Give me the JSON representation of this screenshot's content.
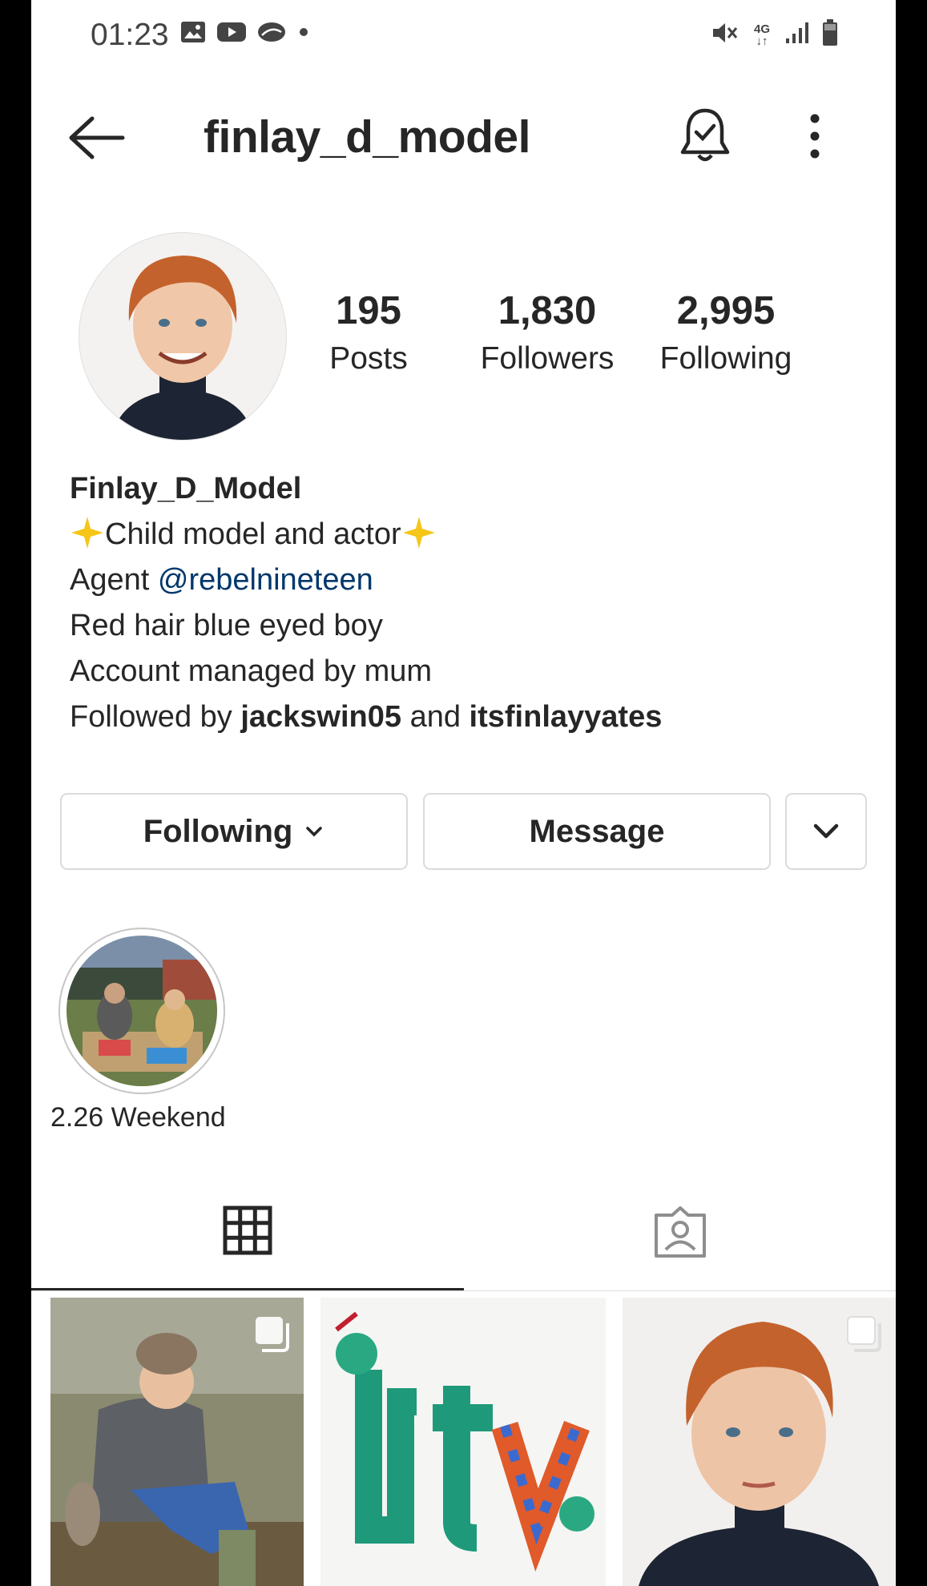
{
  "status_bar": {
    "time": "01:23",
    "left_icons": [
      "gallery-icon",
      "youtube-icon",
      "cloud-icon",
      "dot-icon"
    ],
    "right_icons": [
      "mute-icon",
      "4g-icon",
      "signal-icon",
      "battery-icon"
    ],
    "network": "4G"
  },
  "header": {
    "username": "finlay_d_model",
    "icons": [
      "back-arrow-icon",
      "notification-bell-icon",
      "more-options-icon"
    ]
  },
  "stats": [
    {
      "value": "195",
      "label": "Posts"
    },
    {
      "value": "1,830",
      "label": "Followers"
    },
    {
      "value": "2,995",
      "label": "Following"
    }
  ],
  "bio": {
    "name": "Finlay_D_Model",
    "line1": "Child model and actor",
    "line2_prefix": "Agent ",
    "line2_mention": "@rebelnineteen",
    "line3": "Red hair blue eyed boy",
    "line4": "Account managed by mum",
    "followed_prefix": "Followed by ",
    "followed_user1": "jackswin05",
    "followed_and": " and ",
    "followed_user2": "itsfinlayyates"
  },
  "buttons": {
    "following": "Following",
    "message": "Message"
  },
  "highlights": [
    {
      "label": "2.26 Weekend"
    }
  ],
  "tabs": [
    "grid-icon",
    "tagged-icon"
  ],
  "colors": {
    "mention": "#00376b",
    "text": "#262626",
    "border": "#dbdbdb"
  }
}
